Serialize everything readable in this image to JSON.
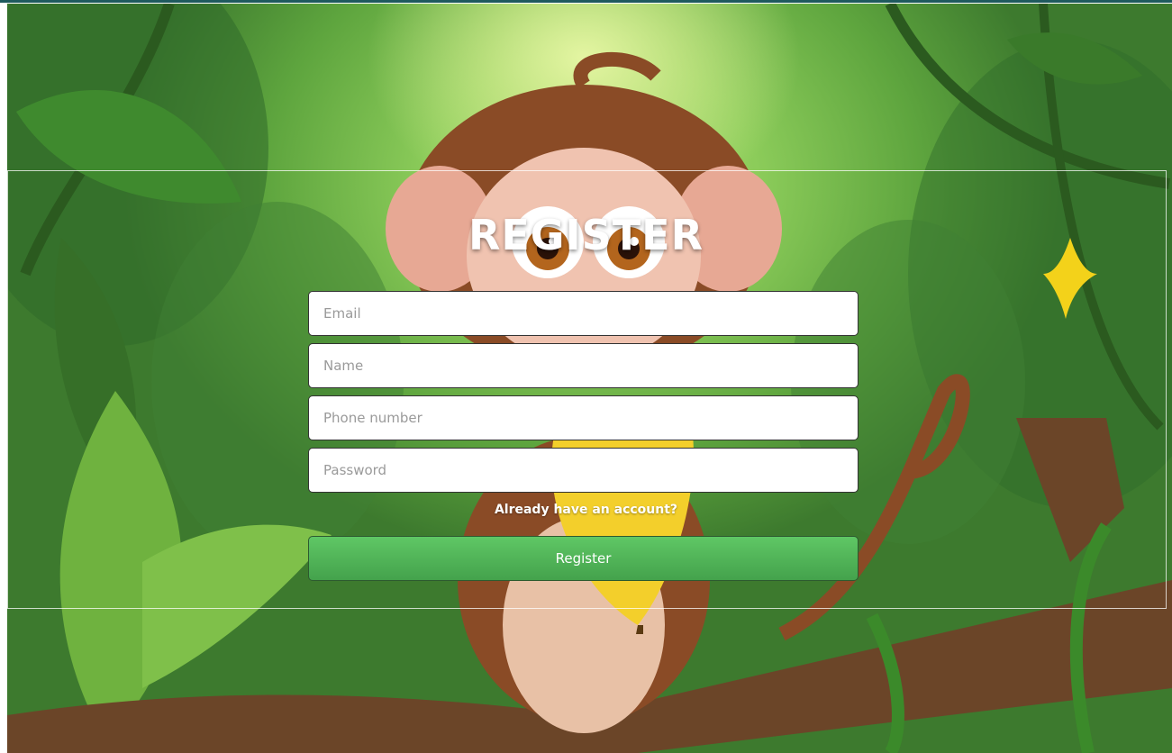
{
  "page": {
    "title": "REGISTER",
    "background": "jungle-monkey-illustration"
  },
  "form": {
    "email_placeholder": "Email",
    "name_placeholder": "Name",
    "phone_placeholder": "Phone number",
    "password_placeholder": "Password",
    "login_link": "Already have an account?",
    "submit_label": "Register"
  },
  "colors": {
    "button": "#4fb556",
    "title": "#ffffff",
    "jungle": "#5ea53e"
  }
}
